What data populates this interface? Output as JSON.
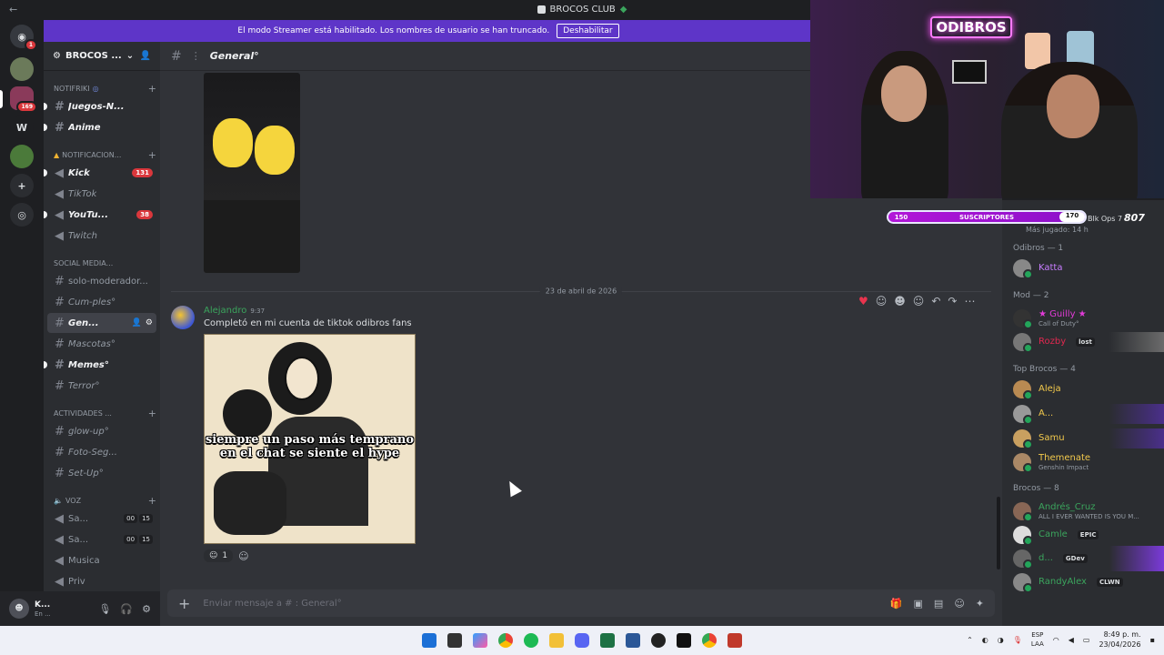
{
  "window": {
    "title": "BROCOS CLUB"
  },
  "banner": {
    "text": "El modo Streamer está habilitado. Los nombres de usuario se han truncado.",
    "button": "Deshabilitar"
  },
  "servers": [
    {
      "label": "",
      "badge": "1"
    },
    {
      "label": "",
      "badge": ""
    },
    {
      "label": "",
      "badge": "169"
    },
    {
      "label": "W",
      "badge": ""
    },
    {
      "label": "",
      "badge": ""
    }
  ],
  "server_name": "BROCOS ...",
  "categories": [
    {
      "name": "NOTIFRIKI",
      "channels": [
        {
          "name": "Juegos-N...",
          "unread": true
        },
        {
          "name": "Anime",
          "unread": true
        }
      ]
    },
    {
      "name": "NOTIFICACION...",
      "channels": [
        {
          "name": "Kick",
          "unread": true,
          "badge": "131"
        },
        {
          "name": "TikTok",
          "unread": false
        },
        {
          "name": "YouTu...",
          "unread": true,
          "badge": "38"
        },
        {
          "name": "Twitch",
          "unread": false
        }
      ]
    },
    {
      "name": "SOCIAL MEDIA...",
      "channels": [
        {
          "name": "solo-moderador...",
          "unread": false
        },
        {
          "name": "Cum-ples°",
          "unread": false
        },
        {
          "name": "Gen...",
          "unread": false,
          "active": true
        },
        {
          "name": "Mascotas°",
          "unread": false
        },
        {
          "name": "Memes°",
          "unread": true
        },
        {
          "name": "Terror°",
          "unread": false
        }
      ]
    },
    {
      "name": "ACTIVIDADES ...",
      "channels": [
        {
          "name": "glow-up°",
          "unread": false
        },
        {
          "name": "Foto-Seg...",
          "unread": false
        },
        {
          "name": "Set-Up°",
          "unread": false
        }
      ]
    },
    {
      "name": "VOZ",
      "channels": [
        {
          "name": "Sa...",
          "voice": [
            "00",
            "15"
          ]
        },
        {
          "name": "Sa...",
          "voice": [
            "00",
            "15"
          ]
        },
        {
          "name": "Musica"
        },
        {
          "name": "Priv"
        }
      ]
    }
  ],
  "user": {
    "name": "K...",
    "status": "En ..."
  },
  "channel_header": {
    "name": "General°"
  },
  "date_divider": "23 de abril de 2026",
  "message": {
    "author": "Alejandro",
    "time": "9:37",
    "text": "Completó en mi cuenta de tiktok odibros fans",
    "meme_caption": "siempre un paso más temprano en el chat se siente el hype",
    "reaction_count": "1"
  },
  "composer": {
    "placeholder": "Enviar mensaje a # : General°"
  },
  "members": {
    "top_partial": "Blk Ops 7",
    "top_partial_sub": "Más jugado: 14 h",
    "groups": [
      {
        "title": "Odibros — 1",
        "items": [
          {
            "name": "Katta",
            "color": "#c77dff"
          }
        ]
      },
      {
        "title": "Mod — 2",
        "items": [
          {
            "name": "★ Guilly ★",
            "color": "#e23bd8",
            "sub": "Call of Duty°"
          },
          {
            "name": "Rozby",
            "color": "#e0284f",
            "tag": "lost"
          }
        ]
      },
      {
        "title": "Top Brocos — 4",
        "items": [
          {
            "name": "Aleja",
            "color": "#f2c94c"
          },
          {
            "name": "A...",
            "color": "#f2c94c"
          },
          {
            "name": "Samu",
            "color": "#f2c94c"
          },
          {
            "name": "Themenate",
            "color": "#f2c94c",
            "sub": "Genshin Impact"
          }
        ]
      },
      {
        "title": "Brocos — 8",
        "items": [
          {
            "name": "Andrés_Cruz",
            "color": "#3ba55d",
            "sub": "ALL I EVER WANTED IS YOU M..."
          },
          {
            "name": "Camle",
            "color": "#3ba55d",
            "tag": "EPIC"
          },
          {
            "name": "d...",
            "color": "#3ba55d",
            "tag": "GDev"
          },
          {
            "name": "RandyAlex",
            "color": "#3ba55d",
            "tag": "CLWN"
          }
        ]
      }
    ]
  },
  "stream_overlay": {
    "sign": "ODIBROS",
    "sub_left": "150",
    "sub_label": "SUSCRIPTORES",
    "sub_right": "170",
    "logo": "807"
  },
  "taskbar": {
    "lang": "ESP",
    "lang2": "LAA",
    "time": "8:49 p. m.",
    "date": "23/04/2026"
  },
  "colors": {
    "accent": "#5e35c8",
    "mention": "#da373c",
    "online": "#23a55a"
  }
}
